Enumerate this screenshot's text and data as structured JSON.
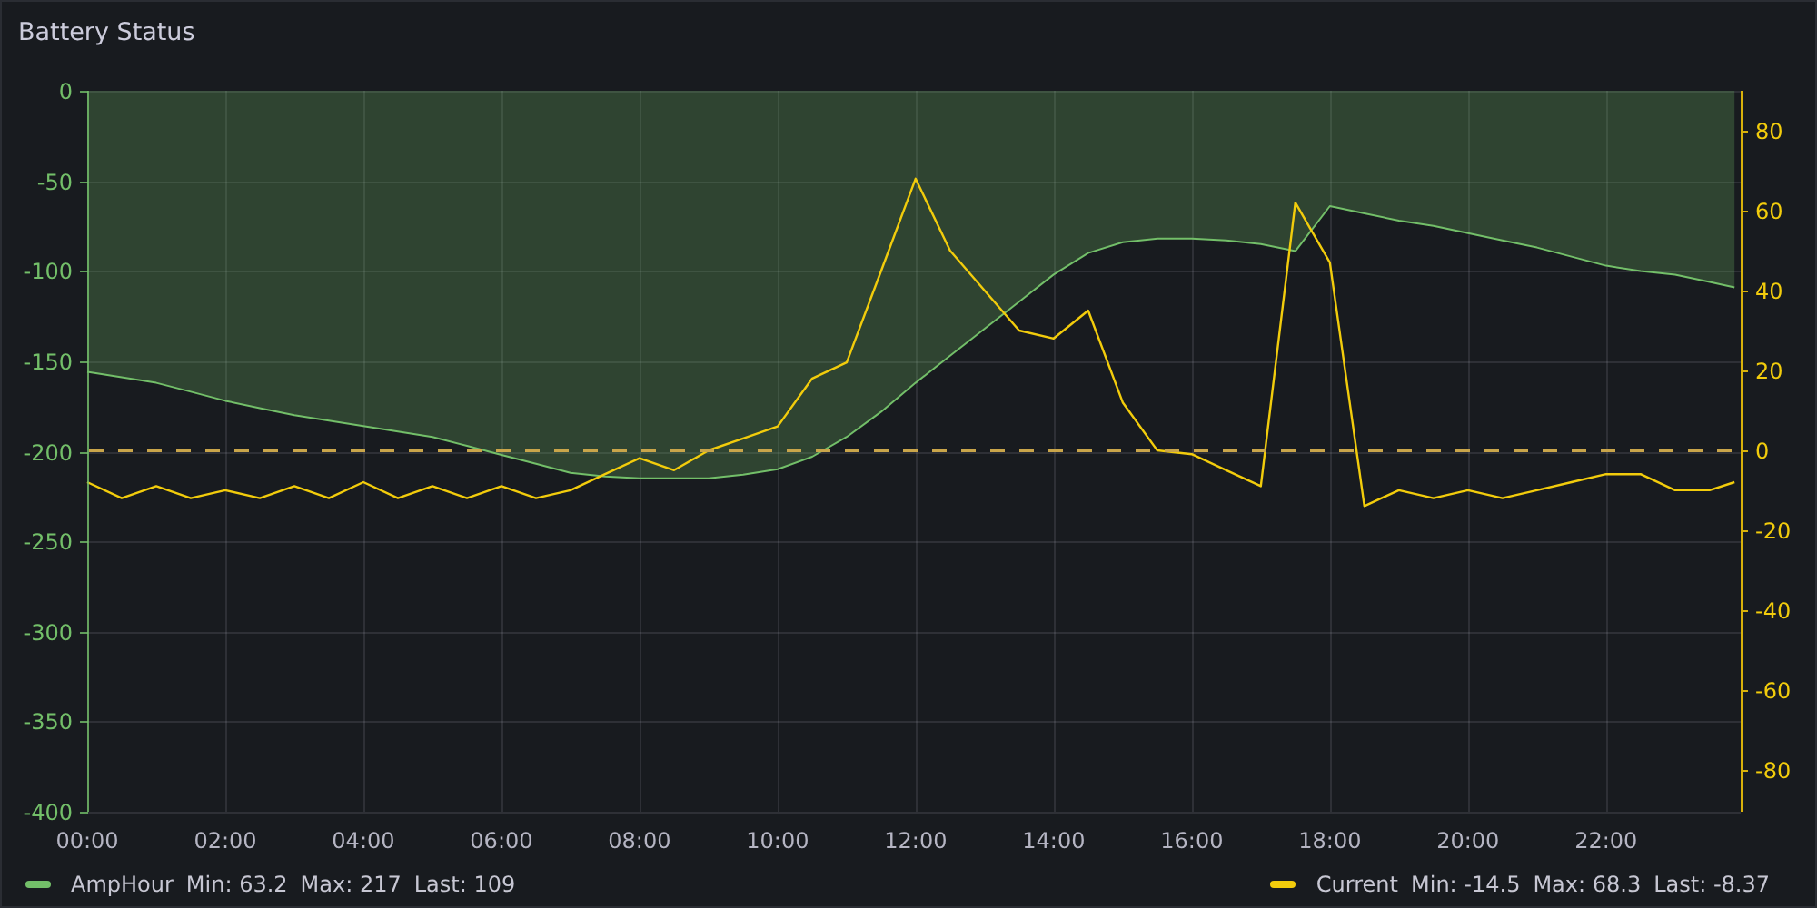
{
  "panel": {
    "title": "Battery Status",
    "chart_data": {
      "type": "line",
      "x": [
        0,
        0.5,
        1,
        1.5,
        2,
        2.5,
        3,
        3.5,
        4,
        4.5,
        5,
        5.5,
        6,
        6.5,
        7,
        7.5,
        8,
        8.5,
        9,
        9.5,
        10,
        10.5,
        11,
        11.5,
        12,
        12.5,
        13,
        13.5,
        14,
        14.5,
        15,
        15.5,
        16,
        16.5,
        17,
        17.5,
        18,
        18.5,
        19,
        19.5,
        20,
        20.5,
        21,
        21.5,
        22,
        22.5,
        23,
        23.5,
        23.86
      ],
      "xlim": [
        0,
        23.95
      ],
      "xticks": [
        {
          "value": 0,
          "label": "00:00"
        },
        {
          "value": 2,
          "label": "02:00"
        },
        {
          "value": 4,
          "label": "04:00"
        },
        {
          "value": 6,
          "label": "06:00"
        },
        {
          "value": 8,
          "label": "08:00"
        },
        {
          "value": 10,
          "label": "10:00"
        },
        {
          "value": 12,
          "label": "12:00"
        },
        {
          "value": 14,
          "label": "14:00"
        },
        {
          "value": 16,
          "label": "16:00"
        },
        {
          "value": 18,
          "label": "18:00"
        },
        {
          "value": 20,
          "label": "20:00"
        },
        {
          "value": 22,
          "label": "22:00"
        }
      ],
      "ylim": [
        -400,
        0
      ],
      "yticks": [
        0,
        -50,
        -100,
        -150,
        -200,
        -250,
        -300,
        -350,
        -400
      ],
      "y2lim": [
        -90.5,
        90
      ],
      "y2ticks": [
        80,
        60,
        40,
        20,
        0,
        -20,
        -40,
        -60,
        -80
      ],
      "series": [
        {
          "name": "AmpHour",
          "color": "#73bf69",
          "type": "area",
          "values": [
            -156,
            -159,
            -162,
            -167,
            -172,
            -176,
            -180,
            -183,
            -186,
            -189,
            -192,
            -197,
            -202,
            -207,
            -212,
            -214,
            -215,
            -215,
            -215,
            -213,
            -210,
            -203,
            -192,
            -178,
            -162,
            -147,
            -132,
            -117,
            -102,
            -90,
            -84,
            -82,
            -82,
            -83,
            -85,
            -89,
            -64,
            -68,
            -72,
            -75,
            -79,
            -83,
            -87,
            -92,
            -97,
            -100,
            -102,
            -106,
            -109
          ]
        },
        {
          "name": "Current",
          "color": "#f2cc0c",
          "type": "line",
          "axis": "y2",
          "values": [
            -8,
            -12,
            -9,
            -12,
            -10,
            -12,
            -9,
            -12,
            -8,
            -12,
            -9,
            -12,
            -9,
            -12,
            -10,
            -6,
            -2,
            -5,
            0,
            3,
            6,
            18,
            22,
            45,
            68,
            50,
            40,
            30,
            28,
            35,
            12,
            0,
            -1,
            -5,
            -9,
            62,
            47,
            -14,
            -10,
            -12,
            -10,
            -12,
            -10,
            -8,
            -6,
            -6,
            -10,
            -10,
            -8
          ]
        }
      ],
      "ref_lines": [
        {
          "value": 0,
          "axis": "y2"
        }
      ],
      "grid": true
    },
    "legend": [
      {
        "stats": [
          "Min: 63.2",
          "Max: 217",
          "Last: 109"
        ]
      },
      {
        "stats": [
          "Min: -14.5",
          "Max: 68.3",
          "Last: -8.37"
        ]
      }
    ]
  }
}
